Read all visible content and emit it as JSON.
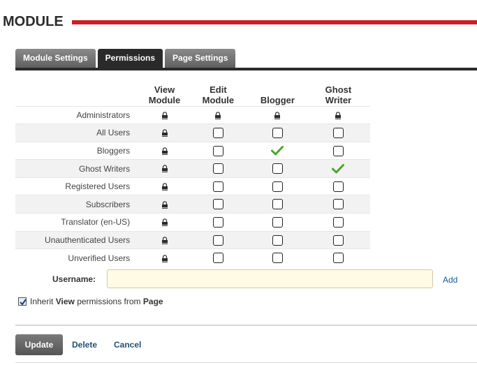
{
  "header": {
    "title": "MODULE",
    "accent_color": "#cc1f24"
  },
  "tabs": [
    {
      "label": "Module Settings",
      "active": false
    },
    {
      "label": "Permissions",
      "active": true
    },
    {
      "label": "Page Settings",
      "active": false
    }
  ],
  "grid": {
    "columns": {
      "view": [
        "View",
        "Module"
      ],
      "edit": [
        "Edit",
        "Module"
      ],
      "blogger": [
        "",
        "Blogger"
      ],
      "ghost": [
        "Ghost",
        "Writer"
      ]
    },
    "rows": [
      {
        "role": "Administrators",
        "view": "lock",
        "edit": "lock",
        "blogger": "lock",
        "ghost": "lock"
      },
      {
        "role": "All Users",
        "view": "lock",
        "edit": "unchecked",
        "blogger": "unchecked",
        "ghost": "unchecked"
      },
      {
        "role": "Bloggers",
        "view": "lock",
        "edit": "unchecked",
        "blogger": "checked",
        "ghost": "unchecked"
      },
      {
        "role": "Ghost Writers",
        "view": "lock",
        "edit": "unchecked",
        "blogger": "unchecked",
        "ghost": "checked"
      },
      {
        "role": "Registered Users",
        "view": "lock",
        "edit": "unchecked",
        "blogger": "unchecked",
        "ghost": "unchecked"
      },
      {
        "role": "Subscribers",
        "view": "lock",
        "edit": "unchecked",
        "blogger": "unchecked",
        "ghost": "unchecked"
      },
      {
        "role": "Translator (en-US)",
        "view": "lock",
        "edit": "unchecked",
        "blogger": "unchecked",
        "ghost": "unchecked"
      },
      {
        "role": "Unauthenticated Users",
        "view": "lock",
        "edit": "unchecked",
        "blogger": "unchecked",
        "ghost": "unchecked"
      },
      {
        "role": "Unverified Users",
        "view": "lock",
        "edit": "unchecked",
        "blogger": "unchecked",
        "ghost": "unchecked"
      }
    ]
  },
  "username": {
    "label": "Username:",
    "value": "",
    "add_label": "Add"
  },
  "inherit": {
    "checked": true,
    "prefix": "Inherit",
    "bold1": "View",
    "middle": "permissions from",
    "bold2": "Page"
  },
  "footer": {
    "update_label": "Update",
    "delete_label": "Delete",
    "cancel_label": "Cancel"
  }
}
